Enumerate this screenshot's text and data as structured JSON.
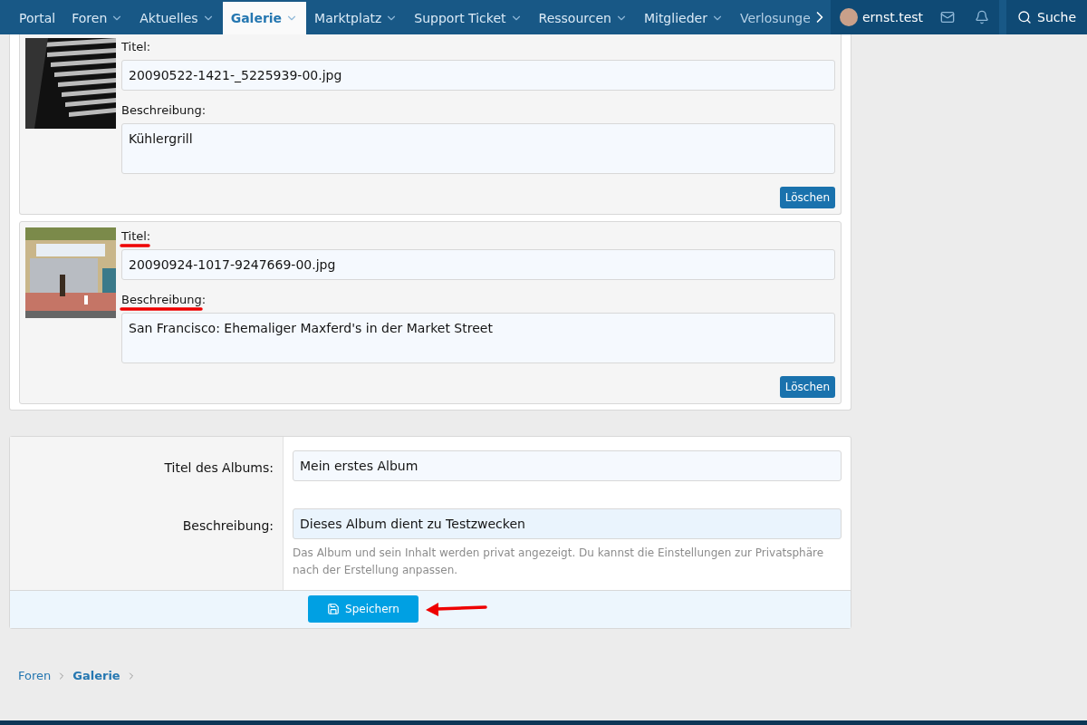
{
  "nav": {
    "items": [
      {
        "label": "Portal",
        "dropdown": false,
        "selected": false
      },
      {
        "label": "Foren",
        "dropdown": true,
        "selected": false
      },
      {
        "label": "Aktuelles",
        "dropdown": true,
        "selected": false
      },
      {
        "label": "Galerie",
        "dropdown": true,
        "selected": true
      },
      {
        "label": "Marktplatz",
        "dropdown": true,
        "selected": false
      },
      {
        "label": "Support Ticket",
        "dropdown": true,
        "selected": false
      },
      {
        "label": "Ressourcen",
        "dropdown": true,
        "selected": false
      },
      {
        "label": "Mitglieder",
        "dropdown": true,
        "selected": false
      },
      {
        "label": "Verlosunge",
        "dropdown": false,
        "selected": false
      }
    ],
    "user": "ernst.test",
    "search": "Suche"
  },
  "media_items": [
    {
      "title_label": "Titel:",
      "title_value": "20090522-1421-_5225939-00.jpg",
      "description_label": "Beschreibung:",
      "description_value": "Kühlergrill",
      "delete": "Löschen",
      "underlined": false
    },
    {
      "title_label": "Titel:",
      "title_value": "20090924-1017-9247669-00.jpg",
      "description_label": "Beschreibung:",
      "description_value": "San Francisco: Ehemaliger Maxferd's in der Market Street",
      "delete": "Löschen",
      "underlined": true
    }
  ],
  "album": {
    "title_label": "Titel des Albums:",
    "title_value": "Mein erstes Album",
    "description_label": "Beschreibung:",
    "description_value": "Dieses Album dient zu Testzwecken",
    "hint": "Das Album und sein Inhalt werden privat angezeigt. Du kannst die Einstellungen zur Privatsphäre nach der Erstellung anpassen.",
    "save": "Speichern",
    "save_arrow": true
  },
  "breadcrumb": [
    {
      "label": "Foren",
      "current": false
    },
    {
      "label": "Galerie",
      "current": true
    }
  ]
}
